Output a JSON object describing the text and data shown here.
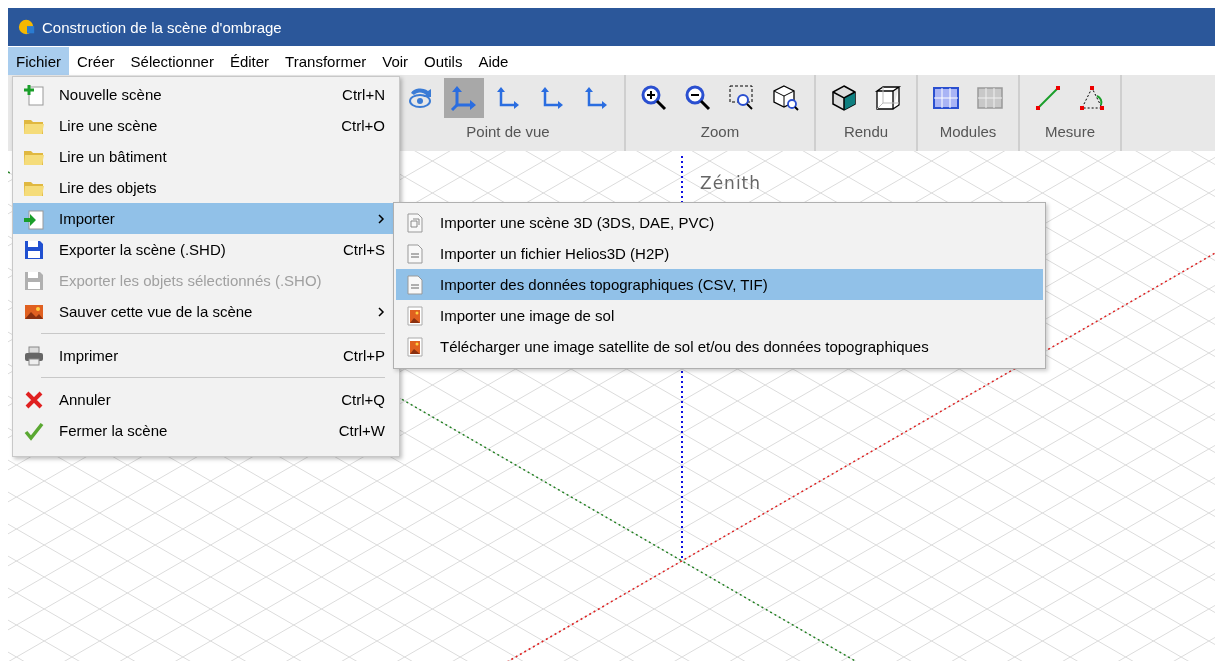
{
  "window": {
    "title": "Construction de la scène d'ombrage"
  },
  "menubar": [
    {
      "label": "Fichier",
      "selected": true
    },
    {
      "label": "Créer",
      "selected": false
    },
    {
      "label": "Sélectionner",
      "selected": false
    },
    {
      "label": "Éditer",
      "selected": false
    },
    {
      "label": "Transformer",
      "selected": false
    },
    {
      "label": "Voir",
      "selected": false
    },
    {
      "label": "Outils",
      "selected": false
    },
    {
      "label": "Aide",
      "selected": false
    }
  ],
  "toolbar": {
    "groups": [
      {
        "label": "Point de vue",
        "buttons": [
          {
            "selected": false
          },
          {
            "selected": true
          },
          {
            "selected": false
          },
          {
            "selected": false
          },
          {
            "selected": false
          }
        ]
      },
      {
        "label": "Zoom",
        "buttons": [
          {
            "selected": false
          },
          {
            "selected": false
          },
          {
            "selected": false
          },
          {
            "selected": false
          }
        ]
      },
      {
        "label": "Rendu",
        "buttons": [
          {
            "selected": false
          },
          {
            "selected": false
          }
        ]
      },
      {
        "label": "Modules",
        "buttons": [
          {
            "selected": false
          },
          {
            "selected": false
          }
        ]
      },
      {
        "label": "Mesure",
        "buttons": [
          {
            "selected": false
          },
          {
            "selected": false
          }
        ]
      }
    ]
  },
  "file_menu": [
    {
      "kind": "item",
      "label": "Nouvelle scène",
      "shortcut": "Ctrl+N",
      "disabled": false,
      "selected": false,
      "submenu": false
    },
    {
      "kind": "item",
      "label": "Lire une scène",
      "shortcut": "Ctrl+O",
      "disabled": false,
      "selected": false,
      "submenu": false
    },
    {
      "kind": "item",
      "label": "Lire un bâtiment",
      "disabled": false,
      "selected": false,
      "submenu": false
    },
    {
      "kind": "item",
      "label": "Lire des objets",
      "disabled": false,
      "selected": false,
      "submenu": false
    },
    {
      "kind": "item",
      "label": "Importer",
      "disabled": false,
      "selected": true,
      "submenu": true
    },
    {
      "kind": "item",
      "label": "Exporter la scène (.SHD)",
      "shortcut": "Ctrl+S",
      "disabled": false,
      "selected": false,
      "submenu": false
    },
    {
      "kind": "item",
      "label": "Exporter les objets sélectionnés (.SHO)",
      "disabled": true,
      "selected": false,
      "submenu": false
    },
    {
      "kind": "item",
      "label": "Sauver cette vue de la scène",
      "disabled": false,
      "selected": false,
      "submenu": true
    },
    {
      "kind": "separator"
    },
    {
      "kind": "item",
      "label": "Imprimer",
      "shortcut": "Ctrl+P",
      "disabled": false,
      "selected": false,
      "submenu": false
    },
    {
      "kind": "separator"
    },
    {
      "kind": "item",
      "label": "Annuler",
      "shortcut": "Ctrl+Q",
      "disabled": false,
      "selected": false,
      "submenu": false
    },
    {
      "kind": "item",
      "label": "Fermer la scène",
      "shortcut": "Ctrl+W",
      "disabled": false,
      "selected": false,
      "submenu": false
    }
  ],
  "import_submenu": [
    {
      "label": "Importer une scène 3D (3DS, DAE, PVC)",
      "selected": false
    },
    {
      "label": "Importer un fichier Helios3D (H2P)",
      "selected": false
    },
    {
      "label": "Importer des données topographiques (CSV, TIF)",
      "selected": true
    },
    {
      "label": "Importer une image de sol",
      "selected": false
    },
    {
      "label": "Télécharger une image satellite de sol et/ou des données topographiques",
      "selected": false
    }
  ],
  "viewport": {
    "axis_label": "Zénith"
  }
}
